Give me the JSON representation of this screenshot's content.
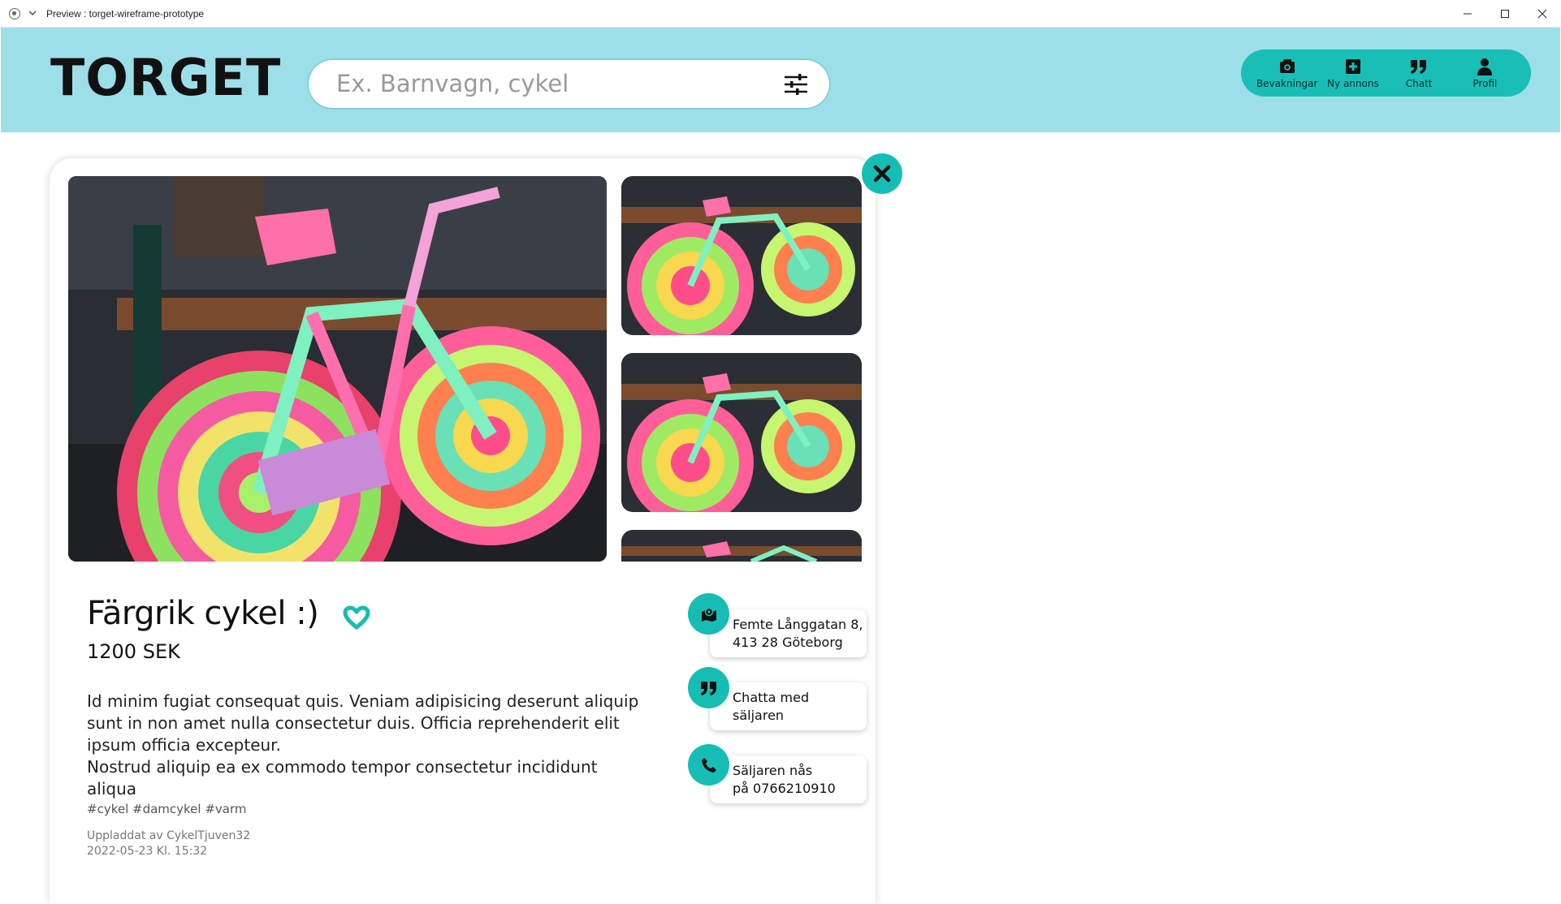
{
  "window": {
    "title": "Preview : torget-wireframe-prototype"
  },
  "header": {
    "logo": "TORGET",
    "search": {
      "placeholder": "Ex. Barnvagn, cykel",
      "value": ""
    },
    "nav": [
      {
        "label": "Bevakningar",
        "icon": "bookmark-camera-icon"
      },
      {
        "label": "Ny annons",
        "icon": "plus-square-icon"
      },
      {
        "label": "Chatt",
        "icon": "quote-icon"
      },
      {
        "label": "Profil",
        "icon": "user-icon"
      }
    ]
  },
  "listing": {
    "title": "Färgrik cykel :)",
    "price": "1200 SEK",
    "description": [
      "Id minim fugiat consequat quis. Veniam adipisicing deserunt aliquip sunt in non amet nulla consectetur duis. Officia reprehenderit elit ipsum officia excepteur.",
      "Nostrud aliquip ea ex commodo tempor consectetur incididunt aliqua"
    ],
    "tags": "#cykel #damcykel #varm",
    "uploaded_by": "Uppladdat av CykelTjuven32",
    "uploaded_at": "2022-05-23 Kl. 15:32",
    "favorite": true,
    "info": {
      "address_line1": "Femte Långgatan 8,",
      "address_line2": "413 28 Göteborg",
      "chat_line1": "Chatta med",
      "chat_line2": "säljaren",
      "phone_line1": "Säljaren nås",
      "phone_line2": "på 0766210910"
    }
  },
  "colors": {
    "header_bg": "#9ddfe9",
    "accent": "#16bdb4",
    "nav_bg": "#19bfb7"
  }
}
